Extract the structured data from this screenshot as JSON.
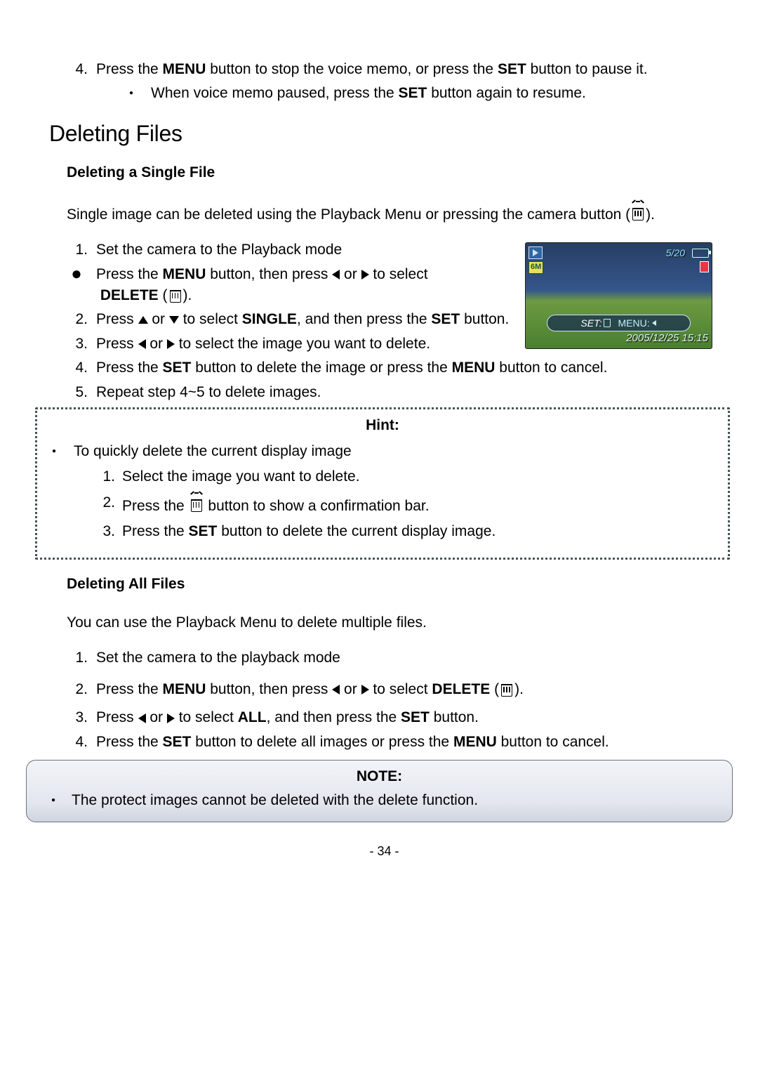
{
  "step4": {
    "num": "4.",
    "t1": "Press the ",
    "menu": "MENU",
    "t2": " button to stop the voice memo, or press the ",
    "set": "SET",
    "t3": " button to pause it.",
    "sub_t1": "When voice memo paused, press the ",
    "sub_set": "SET",
    "sub_t2": " button again to resume."
  },
  "h2_delete": "Deleting Files",
  "h3_single": "Deleting a Single File",
  "intro_single_1": "Single image can be deleted using the Playback Menu or pressing the camera button (",
  "intro_single_2": ").",
  "single": {
    "s1_num": "1.",
    "s1": "Set the camera to the Playback mode",
    "bullet_t1": "Press the ",
    "bullet_menu": "MENU",
    "bullet_t2": " button, then press ",
    "bullet_or": " or ",
    "bullet_t3": " to select ",
    "bullet_delete": "DELETE",
    "bullet_paren1": " (",
    "bullet_paren2": ").",
    "s2_num": "2.",
    "s2_t1": "Press ",
    "s2_or": " or ",
    "s2_t2": " to select ",
    "s2_single": "SINGLE",
    "s2_t3": ", and then press the ",
    "s2_set": "SET",
    "s2_t4": " button.",
    "s3_num": "3.",
    "s3_t1": "Press ",
    "s3_or": " or ",
    "s3_t2": " to select the image you want to delete.",
    "s4_num": "4.",
    "s4_t1": "Press the ",
    "s4_set": "SET",
    "s4_t2": " button to delete the image or press the ",
    "s4_menu": "MENU",
    "s4_t3": " button to cancel.",
    "s5_num": "5.",
    "s5": "Repeat step 4~5 to delete images."
  },
  "hint": {
    "title": "Hint:",
    "lead": "To quickly delete the current display image",
    "s1_num": "1.",
    "s1": "Select the image you want to delete.",
    "s2_num": "2.",
    "s2_t1": "Press the ",
    "s2_t2": " button to show a confirmation bar.",
    "s3_num": "3.",
    "s3_t1": "Press the ",
    "s3_set": "SET",
    "s3_t2": " button to delete the current display image."
  },
  "h3_all": "Deleting All Files",
  "all_intro": "You can use the Playback Menu to delete multiple files.",
  "all": {
    "s1_num": "1.",
    "s1": "Set the camera to the playback mode",
    "s2_num": "2.",
    "s2_t1": "Press the ",
    "s2_menu": "MENU",
    "s2_t2": " button, then press ",
    "s2_or": " or ",
    "s2_t3": " to select ",
    "s2_delete": "DELETE",
    "s2_p1": " (",
    "s2_p2": ").",
    "s3_num": "3.",
    "s3_t1": "Press ",
    "s3_or": " or ",
    "s3_t2": " to select ",
    "s3_all": "ALL",
    "s3_t3": ", and then press the ",
    "s3_set": "SET",
    "s3_t4": " button.",
    "s4_num": "4.",
    "s4_t1": "Press the ",
    "s4_set": "SET",
    "s4_t2": " button to delete all images or press the ",
    "s4_menu": "MENU",
    "s4_t3": " button to cancel."
  },
  "note": {
    "title": "NOTE:",
    "body": "The protect images cannot be deleted with the delete function."
  },
  "shot": {
    "count": "5/20",
    "size": "6M",
    "set": "SET:",
    "menu": "MENU:",
    "ts": "2005/12/25 15:15"
  },
  "footer": "- 34 -"
}
